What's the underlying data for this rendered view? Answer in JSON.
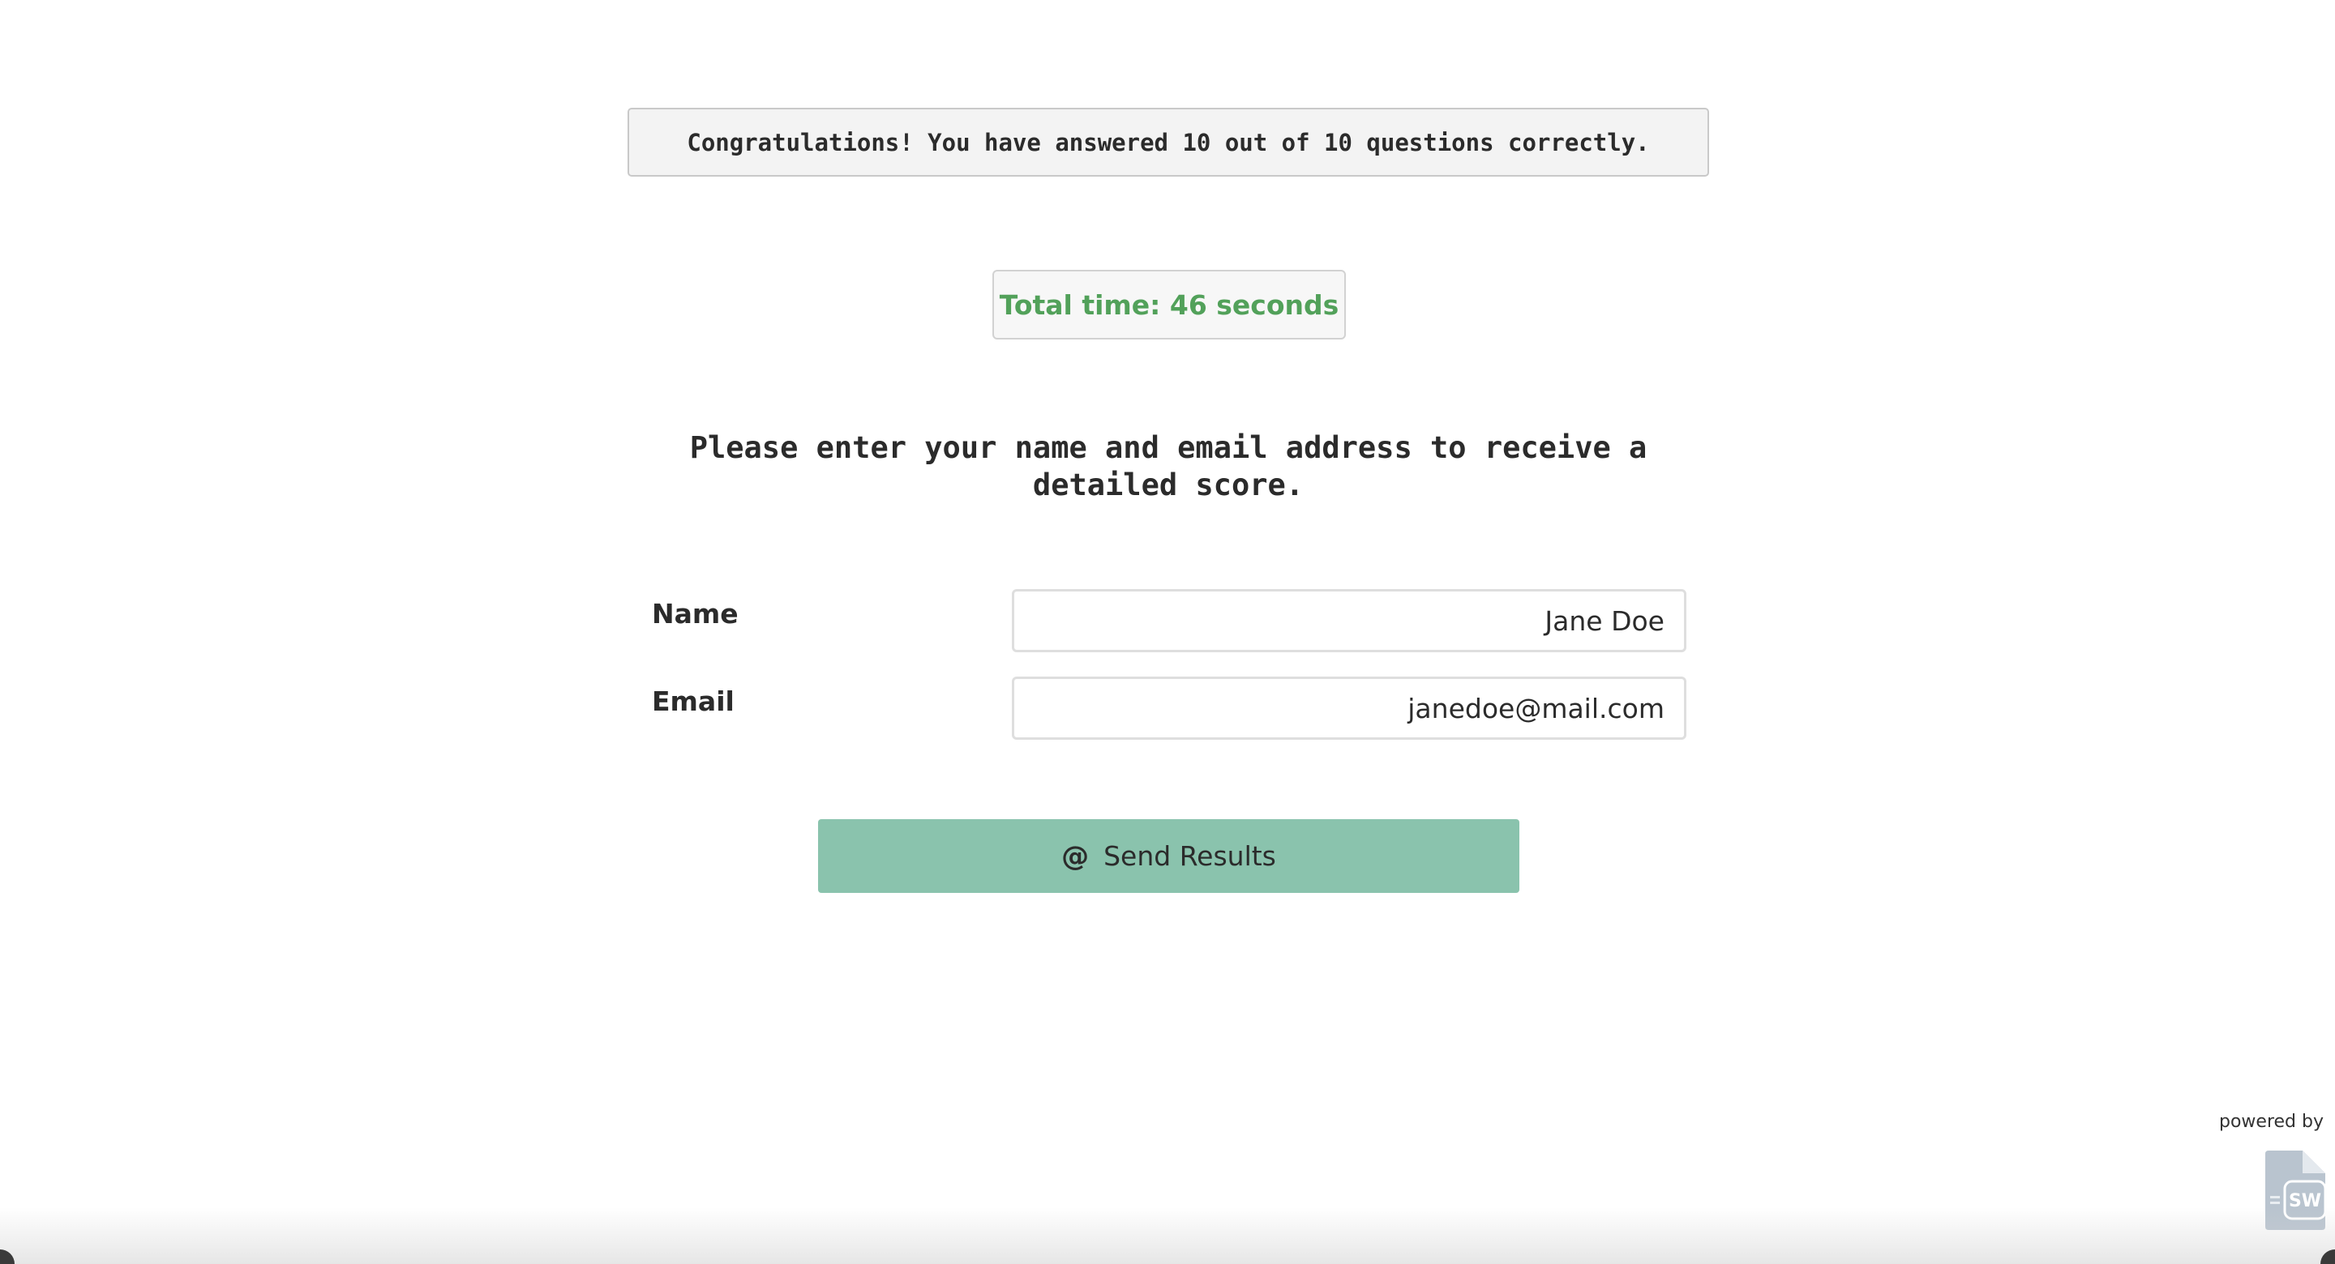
{
  "results": {
    "score_message": "Congratulations! You have answered 10 out of 10 questions correctly.",
    "total_time": "Total time: 46 seconds"
  },
  "form": {
    "prompt": "Please enter your name and email address to receive a detailed score.",
    "name_label": "Name",
    "name_value": "Jane Doe",
    "email_label": "Email",
    "email_value": "janedoe@mail.com",
    "send_button_label": "Send Results",
    "send_button_icon": "at-icon"
  },
  "footer": {
    "powered_by": "powered by",
    "logo_text": "SW",
    "logo_icon": "document-logo-icon"
  },
  "colors": {
    "time_text": "#52a15a",
    "button_background": "#8ac3ad"
  }
}
